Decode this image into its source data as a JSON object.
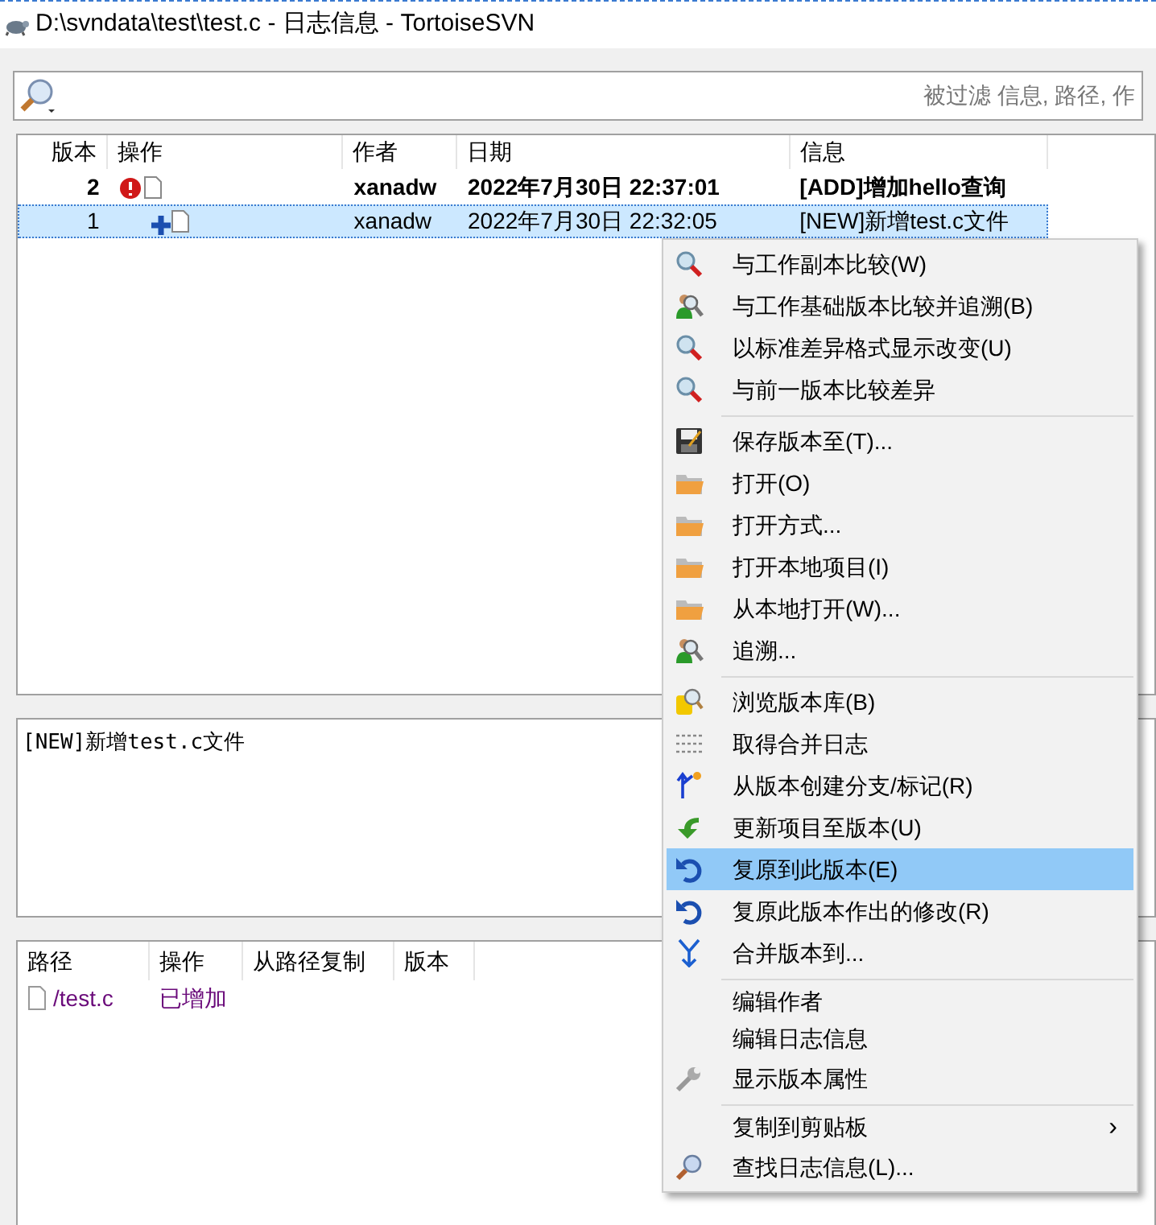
{
  "window": {
    "title": "D:\\svndata\\test\\test.c - 日志信息 - TortoiseSVN"
  },
  "filter": {
    "placeholder": "被过滤 信息, 路径, 作"
  },
  "log": {
    "columns": [
      "版本",
      "操作",
      "作者",
      "日期",
      "信息"
    ],
    "rows": [
      {
        "revision": "2",
        "kind": "modified",
        "author": "xanadw",
        "date": "2022年7月30日 22:37:01",
        "message": "[ADD]增加hello查询",
        "bold": true,
        "selected": false
      },
      {
        "revision": "1",
        "kind": "added",
        "author": "xanadw",
        "date": "2022年7月30日 22:32:05",
        "message": "[NEW]新增test.c文件",
        "bold": false,
        "selected": true
      }
    ]
  },
  "message_pane": {
    "text": "[NEW]新增test.c文件"
  },
  "paths": {
    "columns": [
      "路径",
      "操作",
      "从路径复制",
      "版本"
    ],
    "rows": [
      {
        "path": "/test.c",
        "action": "已增加"
      }
    ]
  },
  "context_menu": {
    "items": [
      {
        "kind": "magnifier",
        "label": "与工作副本比较(W)",
        "selected": false
      },
      {
        "kind": "person-magnifier",
        "label": "与工作基础版本比较并追溯(B)",
        "selected": false
      },
      {
        "kind": "magnifier",
        "label": "以标准差异格式显示改变(U)",
        "selected": false
      },
      {
        "kind": "magnifier",
        "label": "与前一版本比较差异",
        "selected": false
      },
      {
        "kind": "separator"
      },
      {
        "kind": "disk",
        "label": "保存版本至(T)...",
        "selected": false
      },
      {
        "kind": "folder",
        "label": "打开(O)",
        "selected": false
      },
      {
        "kind": "folder",
        "label": "打开方式...",
        "selected": false
      },
      {
        "kind": "folder",
        "label": "打开本地项目(I)",
        "selected": false
      },
      {
        "kind": "folder",
        "label": "从本地打开(W)...",
        "selected": false
      },
      {
        "kind": "person-magnifier",
        "label": "追溯...",
        "selected": false
      },
      {
        "kind": "separator"
      },
      {
        "kind": "repository",
        "label": "浏览版本库(B)",
        "selected": false
      },
      {
        "kind": "lines",
        "label": "取得合并日志",
        "selected": false
      },
      {
        "kind": "branch",
        "label": "从版本创建分支/标记(R)",
        "selected": false
      },
      {
        "kind": "update",
        "label": "更新项目至版本(U)",
        "selected": false
      },
      {
        "kind": "undo",
        "label": "复原到此版本(E)",
        "selected": true
      },
      {
        "kind": "undo",
        "label": "复原此版本作出的修改(R)",
        "selected": false
      },
      {
        "kind": "merge",
        "label": "合并版本到...",
        "selected": false
      },
      {
        "kind": "separator"
      },
      {
        "kind": "plain",
        "label": "编辑作者",
        "selected": false
      },
      {
        "kind": "plain",
        "label": "编辑日志信息",
        "selected": false
      },
      {
        "kind": "wrench",
        "label": "显示版本属性",
        "selected": false
      },
      {
        "kind": "separator"
      },
      {
        "kind": "plain",
        "label": "复制到剪贴板",
        "submenu_arrow": "›",
        "selected": false
      },
      {
        "kind": "find",
        "label": "查找日志信息(L)...",
        "selected": false
      }
    ]
  }
}
